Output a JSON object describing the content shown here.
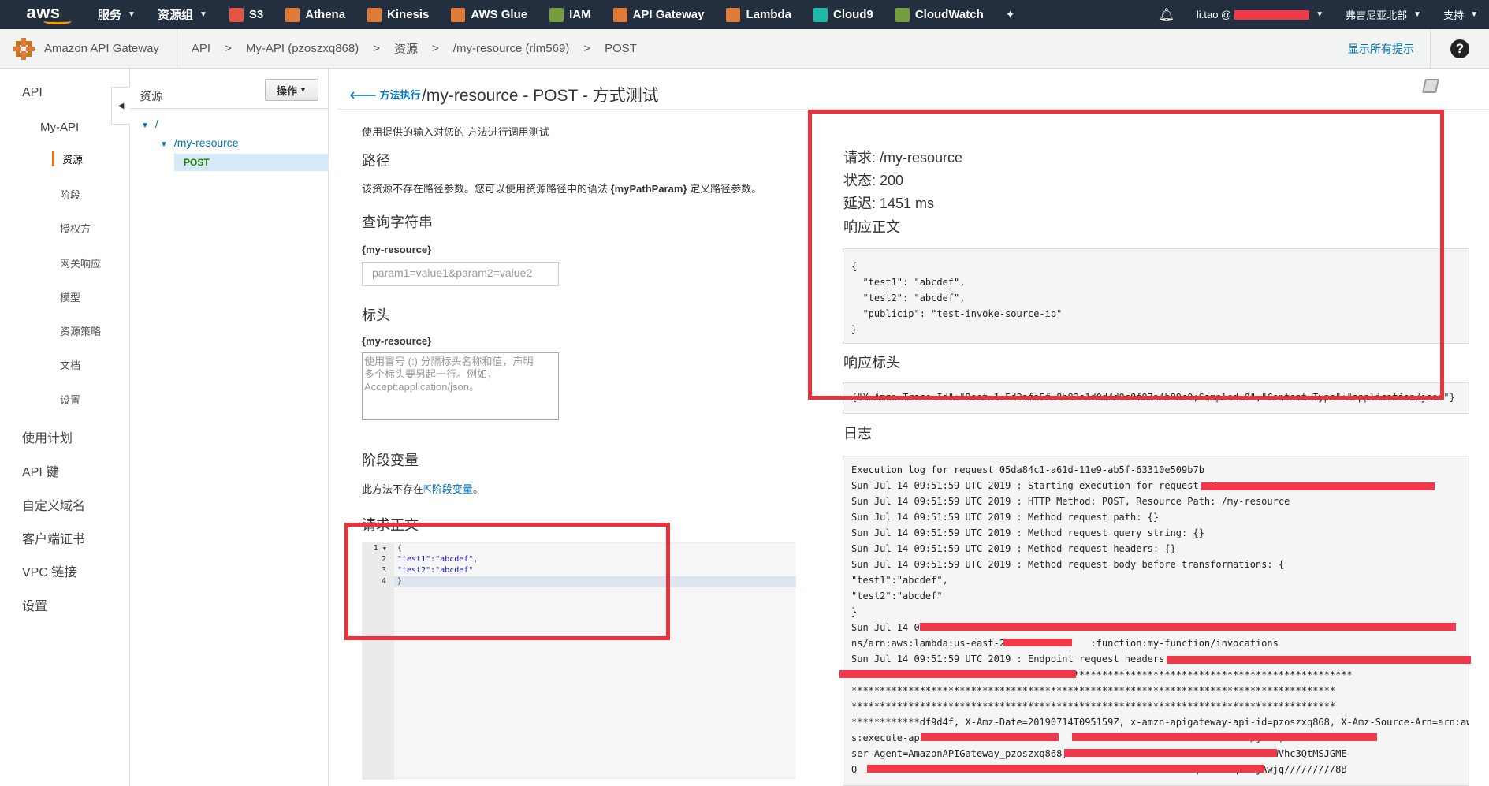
{
  "topnav": {
    "logo": "aws",
    "services": "服务",
    "resource_groups": "资源组",
    "favorites": [
      {
        "label": "S3",
        "color": "#e25444"
      },
      {
        "label": "Athena",
        "color": "#e07b39"
      },
      {
        "label": "Kinesis",
        "color": "#e07b39"
      },
      {
        "label": "AWS Glue",
        "color": "#e07b39"
      },
      {
        "label": "IAM",
        "color": "#759c3e"
      },
      {
        "label": "API Gateway",
        "color": "#e07b39"
      },
      {
        "label": "Lambda",
        "color": "#e07b39"
      },
      {
        "label": "Cloud9",
        "color": "#1fb8a6"
      },
      {
        "label": "CloudWatch",
        "color": "#759c3e"
      }
    ],
    "user": "li.tao @",
    "region": "弗吉尼亚北部",
    "support": "支持"
  },
  "breadcrumb": {
    "service": "Amazon API Gateway",
    "items": [
      "API",
      ">",
      "My-API (pzoszxq868)",
      ">",
      "资源",
      ">",
      "/my-resource (rlm569)",
      ">",
      "POST"
    ],
    "hints": "显示所有提示",
    "help": "?"
  },
  "sidebar": {
    "api": "API",
    "my_api": "My-API",
    "sub_items": [
      "资源",
      "阶段",
      "授权方",
      "网关响应",
      "模型",
      "资源策略",
      "文档",
      "设置"
    ],
    "bottom_items": [
      "使用计划",
      "API 键",
      "自定义域名",
      "客户端证书",
      "VPC 链接",
      "设置"
    ]
  },
  "resources": {
    "title": "资源",
    "actions": "操作",
    "root": "/",
    "child": "/my-resource",
    "method": "POST"
  },
  "main": {
    "back": "方法执行",
    "title": "/my-resource - POST - 方式测试",
    "intro": "使用提供的输入对您的 方法进行调用测试",
    "path_heading": "路径",
    "path_text_pre": "该资源不存在路径参数。您可以使用资源路径中的语法 ",
    "path_param": "{myPathParam}",
    "path_text_post": " 定义路径参数。",
    "query_heading": "查询字符串",
    "query_label": "{my-resource}",
    "query_placeholder": "param1=value1&param2=value2",
    "headers_heading": "标头",
    "headers_label": "{my-resource}",
    "headers_placeholder_1": "使用冒号 (:) 分隔标头名称和值，声明",
    "headers_placeholder_2": "多个标头要另起一行。例如，",
    "headers_placeholder_3": "Accept:application/json。",
    "stage_heading": "阶段变量",
    "stage_text": "此方法不存在",
    "stage_link": "阶段变量",
    "stage_text_end": "。",
    "body_heading": "请求正文",
    "editor_lines": [
      "1",
      "2",
      "3",
      "4"
    ],
    "editor_code": [
      "{",
      "\"test1\":\"abcdef\",",
      "\"test2\":\"abcdef\"",
      "}"
    ]
  },
  "response": {
    "request": "请求: /my-resource",
    "status": "状态: 200",
    "latency": "延迟: 1451 ms",
    "body_heading": "响应正文",
    "body_lines": [
      "{",
      "  \"test1\": \"abcdef\",",
      "  \"test2\": \"abcdef\",",
      "  \"publicip\": \"test-invoke-source-ip\"",
      "}"
    ],
    "headers_heading": "响应标头",
    "headers_line": "{\"X-Amzn-Trace-Id\":\"Root=1-5d2afa5f-8b82e1d0d4d0c8f97a4b89c0;Sampled=0\",\"Content-Type\":\"application/json\"}",
    "log_heading": "日志",
    "log_lines": [
      "Execution log for request 05da84c1-a61d-11e9-ab5f-63310e509b7b",
      "Sun Jul 14 09:51:59 UTC 2019 : Starting execution for request: 0",
      "Sun Jul 14 09:51:59 UTC 2019 : HTTP Method: POST, Resource Path: /my-resource",
      "Sun Jul 14 09:51:59 UTC 2019 : Method request path: {}",
      "Sun Jul 14 09:51:59 UTC 2019 : Method request query string: {}",
      "Sun Jul 14 09:51:59 UTC 2019 : Method request headers: {}",
      "Sun Jul 14 09:51:59 UTC 2019 : Method request body before transformations: {",
      "\"test1\":\"abcdef\",",
      "\"test2\":\"abcdef\"",
      "}",
      "Sun Jul 14 09",
      "ns/arn:aws:lambda:us-east-2:              :function:my-function/invocations",
      "Sun Jul 14 09:51:59 UTC 2019 : Endpoint request headers: ",
      "                             ***********************************************************",
      "*************************************************************************************",
      "*************************************************************************************",
      "************df9d4f, X-Amz-Date=20190714T095159Z, x-amzn-apigateway-api-id=pzoszxq868, X-Amz-Source-Arn=arn:aw",
      "s:execute-api                 zo                               ication/json, U",
      "ser-Agent=AmazonAPIGateway_pzoszxq868,                              aCXVzLWVhc3QtMSJGME",
      "Q                                                    EdBCk07qveSoPXqdCrjAwjq/////////8B"
    ]
  }
}
